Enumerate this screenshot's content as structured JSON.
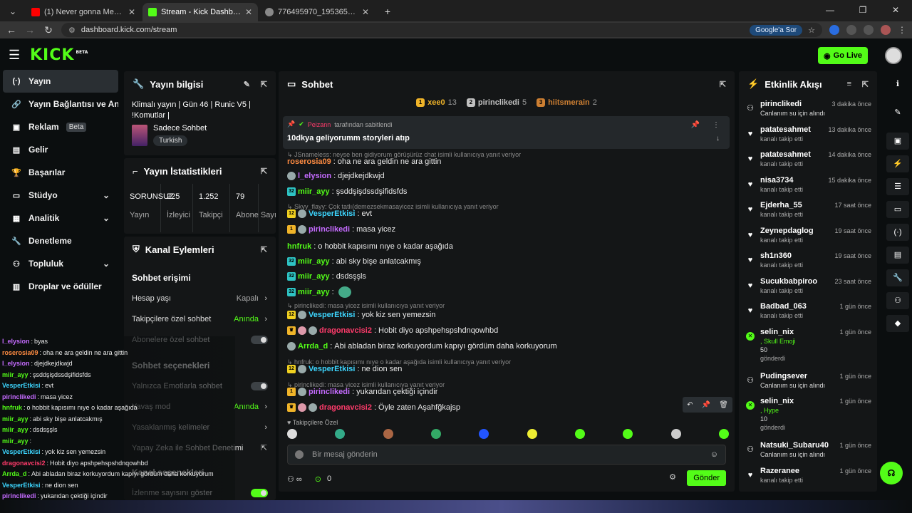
{
  "browser": {
    "tabs": [
      {
        "title": "(1) Never gonna Meow you up",
        "color": "#ff0000"
      },
      {
        "title": "Stream - Kick Dashboard",
        "color": "#53fc18"
      },
      {
        "title": "776495970_19536510419804933",
        "color": "#888888"
      }
    ],
    "url": "dashboard.kick.com/stream",
    "google_pill": "Google'a Sor"
  },
  "header": {
    "logo": "KICK",
    "logo_sup": "BETA",
    "go_live": "Go Live"
  },
  "nav": [
    {
      "label": "Yayın",
      "icon": "broadcast-icon",
      "active": true
    },
    {
      "label": "Yayın Bağlantısı ve Anahtarı",
      "icon": "link-icon"
    },
    {
      "label": "Reklam",
      "icon": "ad-icon",
      "badge": "Beta"
    },
    {
      "label": "Gelir",
      "icon": "revenue-icon"
    },
    {
      "label": "Başarılar",
      "icon": "trophy-icon"
    },
    {
      "label": "Stüdyo",
      "icon": "studio-icon",
      "chev": true
    },
    {
      "label": "Analitik",
      "icon": "analytics-icon",
      "chev": true
    },
    {
      "label": "Denetleme",
      "icon": "moderation-icon"
    },
    {
      "label": "Topluluk",
      "icon": "community-icon",
      "chev": true
    },
    {
      "label": "Droplar ve ödüller",
      "icon": "drops-icon"
    }
  ],
  "stream_info": {
    "title": "Yayın bilgisi",
    "stream_title": "Klimalı yayın | Gün 46 | Runic V5 | !Komutlar |",
    "category": "Sadece Sohbet",
    "tag": "Turkish"
  },
  "stats": {
    "title": "Yayın İstatistikleri",
    "items": [
      {
        "value": "SORUNSUZ",
        "label": "Yayın"
      },
      {
        "value": "225",
        "label": "İzleyici"
      },
      {
        "value": "1.252",
        "label": "Takipçi"
      },
      {
        "value": "79",
        "label": "Abone Sayısı"
      }
    ]
  },
  "channel_actions": {
    "title": "Kanal Eylemleri",
    "chat_access": "Sohbet erişimi",
    "rows1": [
      {
        "label": "Hesap yaşı",
        "value": "Kapalı",
        "kind": "arrow"
      },
      {
        "label": "Takipçilere özel sohbet",
        "value": "Anında",
        "kind": "arrow",
        "green": true
      },
      {
        "label": "Abonelere özel sohbet",
        "kind": "toggle"
      }
    ],
    "chat_options": "Sohbet seçenekleri",
    "rows2": [
      {
        "label": "Yalnızca Emotlarla sohbet",
        "kind": "toggle"
      },
      {
        "label": "Yavaş mod",
        "value": "Anında",
        "kind": "arrow",
        "green": true
      },
      {
        "label": "Yasaklanmış kelimeler",
        "kind": "arrow"
      },
      {
        "label": "Yapay Zeka ile Sohbet Denetimi",
        "kind": "external"
      }
    ],
    "channel_options": "Kanal seçenekleri",
    "rows3": [
      {
        "label": "İzlenme sayısını göster",
        "kind": "toggle-on"
      }
    ]
  },
  "chat": {
    "title": "Sohbet",
    "top_gifters": [
      {
        "rank": "1",
        "name": "xee0",
        "count": "13",
        "color": "#f0b429"
      },
      {
        "rank": "2",
        "name": "pirinclikedi",
        "count": "5",
        "color": "#c0c0c0"
      },
      {
        "rank": "3",
        "name": "hiitsmerain",
        "count": "2",
        "color": "#cd7f32"
      }
    ],
    "pinned": {
      "by_user": "Peizann",
      "by_text": "tarafından sabitlendi",
      "message": "10dkya geliyorumm storyleri atıp"
    },
    "messages": [
      {
        "reply": "JSnameless: neyse ben gidiyorum görüşürüz chat isimli kullanıcıya yanıt veriyor"
      },
      {
        "user": "roserosia09",
        "color": "#ff8c42",
        "text": "oha ne ara geldin ne ara gittin"
      },
      {
        "user": "l_elysion",
        "color": "#c56bff",
        "text": "djejdkejdkwjd",
        "av": true
      },
      {
        "user": "miir_ayy",
        "color": "#53fc18",
        "text": "şsddşişdssdşifidsfds",
        "badge": "32",
        "bc": "#2ec4c4"
      },
      {
        "reply": "Skyy_flayy: Çok tatlı(demezsekmasayicez isimli kullanıcıya yanıt veriyor"
      },
      {
        "user": "VesperEtkisi",
        "color": "#3dd6ff",
        "text": "evt",
        "badge": "12",
        "bc": "#f0d020",
        "av": true
      },
      {
        "user": "pirinclikedi",
        "color": "#c56bff",
        "text": "masa yicez",
        "badge": "1",
        "bc": "#f0b429",
        "av": true
      },
      {
        "user": "hnfruk",
        "color": "#53fc18",
        "text": "o hobbit kapısımı nıye o kadar aşağıda"
      },
      {
        "user": "miir_ayy",
        "color": "#53fc18",
        "text": "abi sky bişe anlatcakmış",
        "badge": "32",
        "bc": "#2ec4c4"
      },
      {
        "user": "miir_ayy",
        "color": "#53fc18",
        "text": "dsdsşşls",
        "badge": "32",
        "bc": "#2ec4c4"
      },
      {
        "user": "miir_ayy",
        "color": "#53fc18",
        "text": "",
        "badge": "32",
        "bc": "#2ec4c4",
        "emote": true
      },
      {
        "reply": "pirinclikedi: masa yicez isimli kullanıcıya yanıt veriyor"
      },
      {
        "user": "VesperEtkisi",
        "color": "#3dd6ff",
        "text": "yok kiz sen yemezsin",
        "badge": "12",
        "bc": "#f0d020",
        "av": true
      },
      {
        "user": "dragonavcisi2",
        "color": "#ff3b6b",
        "text": "Hobit diyo apshpehspshdnqowhbd",
        "badge": "",
        "bc": "#f0b429",
        "av": true,
        "av2": true
      },
      {
        "user": "Arrda_d",
        "color": "#53fc18",
        "text": "Abi abladan biraz korkuyordum kapıyı gördüm daha korkuyorum",
        "av": true
      },
      {
        "reply": "hnfruk: o hobbit kapısımı nıye o kadar aşağıda isimli kullanıcıya yanıt veriyor"
      },
      {
        "user": "VesperEtkisi",
        "color": "#3dd6ff",
        "text": "ne dion sen",
        "badge": "12",
        "bc": "#f0d020",
        "av": true
      },
      {
        "reply": "pirinclikedi: masa yicez isimli kullanıcıya yanıt veriyor"
      },
      {
        "user": "pirinclikedi",
        "color": "#c56bff",
        "text": "yukarıdan çektiği içindir",
        "badge": "1",
        "bc": "#f0b429",
        "av": true
      },
      {
        "user": "dragonavcisi2",
        "color": "#ff3b6b",
        "text": "Öyle zaten Aşahfğkajsp",
        "badge": "",
        "bc": "#f0b429",
        "av": true,
        "av2": true
      }
    ],
    "followers_only": "Takipçilere Özel",
    "input_placeholder": "Bir mesaj gönderin",
    "points": "0",
    "send": "Gönder"
  },
  "feed": {
    "title": "Etkinlik Akışı",
    "events": [
      {
        "name": "pirinclikedi",
        "desc": "Canlanım su için alındı",
        "time": "3 dakika önce",
        "kind": "reward"
      },
      {
        "name": "patatesahmet",
        "desc": "kanalı takip etti",
        "time": "13 dakika önce",
        "kind": "follow"
      },
      {
        "name": "patatesahmet",
        "desc": "kanalı takip etti",
        "time": "14 dakika önce",
        "kind": "follow"
      },
      {
        "name": "nisa3734",
        "desc": "kanalı takip etti",
        "time": "15 dakika önce",
        "kind": "follow"
      },
      {
        "name": "Ejderha_55",
        "desc": "kanalı takip etti",
        "time": "17 saat önce",
        "kind": "follow"
      },
      {
        "name": "Zeynepdaglog",
        "desc": "kanalı takip etti",
        "time": "19 saat önce",
        "kind": "follow"
      },
      {
        "name": "sh1n360",
        "desc": "kanalı takip etti",
        "time": "19 saat önce",
        "kind": "follow"
      },
      {
        "name": "Sucukbabpiroo",
        "desc": "kanalı takip etti",
        "time": "23 saat önce",
        "kind": "follow"
      },
      {
        "name": "Badbad_063",
        "desc": "kanalı takip etti",
        "time": "1 gün önce",
        "kind": "follow"
      },
      {
        "name": "selin_nix",
        "desc": ", Skull Emoji",
        "amount": "50",
        "extra": "gönderdi",
        "time": "1 gün önce",
        "kind": "kicks"
      },
      {
        "name": "Pudingsever",
        "desc": "Canlanım su için alındı",
        "time": "1 gün önce",
        "kind": "reward"
      },
      {
        "name": "selin_nix",
        "desc": ", Hype",
        "amount": "10",
        "extra": "gönderdi",
        "time": "1 gün önce",
        "kind": "kicks"
      },
      {
        "name": "Natsuki_Subaru40",
        "desc": "Canlanım su için alındı",
        "time": "1 gün önce",
        "kind": "reward"
      },
      {
        "name": "Razeranee",
        "desc": "kanalı takip etti",
        "time": "1 gün önce",
        "kind": "follow"
      }
    ]
  },
  "overlay": [
    {
      "u": "l_elysion",
      "t": "byas",
      "c": "#c56bff"
    },
    {
      "u": "roserosia09",
      "t": "oha ne ara geldin ne ara gittin",
      "c": "#ff8c42"
    },
    {
      "u": "l_elysion",
      "t": "djejdkejdkwjd",
      "c": "#c56bff"
    },
    {
      "u": "miir_ayy",
      "t": "şsddşişdssdşifidsfds",
      "c": "#53fc18"
    },
    {
      "u": "VesperEtkisi",
      "t": "evt",
      "c": "#3dd6ff"
    },
    {
      "u": "pirinclikedi",
      "t": "masa yicez",
      "c": "#c56bff"
    },
    {
      "u": "hnfruk",
      "t": "o hobbit kapısımı nıye o kadar aşağıda",
      "c": "#53fc18"
    },
    {
      "u": "miir_ayy",
      "t": "abi sky bişe anlatcakmış",
      "c": "#53fc18"
    },
    {
      "u": "miir_ayy",
      "t": "dsdsşşls",
      "c": "#53fc18"
    },
    {
      "u": "miir_ayy",
      "t": "",
      "c": "#53fc18"
    },
    {
      "u": "VesperEtkisi",
      "t": "yok kiz sen yemezsin",
      "c": "#3dd6ff"
    },
    {
      "u": "dragonavcisi2",
      "t": "Hobit diyo apshpehspshdnqowhbd",
      "c": "#ff3b6b"
    },
    {
      "u": "Arrda_d",
      "t": "Abi abladan biraz korkuyordum kapıyı gördüm daha korkuyorum",
      "c": "#53fc18"
    },
    {
      "u": "VesperEtkisi",
      "t": "ne dion sen",
      "c": "#3dd6ff"
    },
    {
      "u": "pirinclikedi",
      "t": "yukarıdan çektiği içindir",
      "c": "#c56bff"
    },
    {
      "u": "dragonavcisi2",
      "t": "Öyle zaten Aşahfğkajsp",
      "c": "#ff3b6b"
    }
  ]
}
